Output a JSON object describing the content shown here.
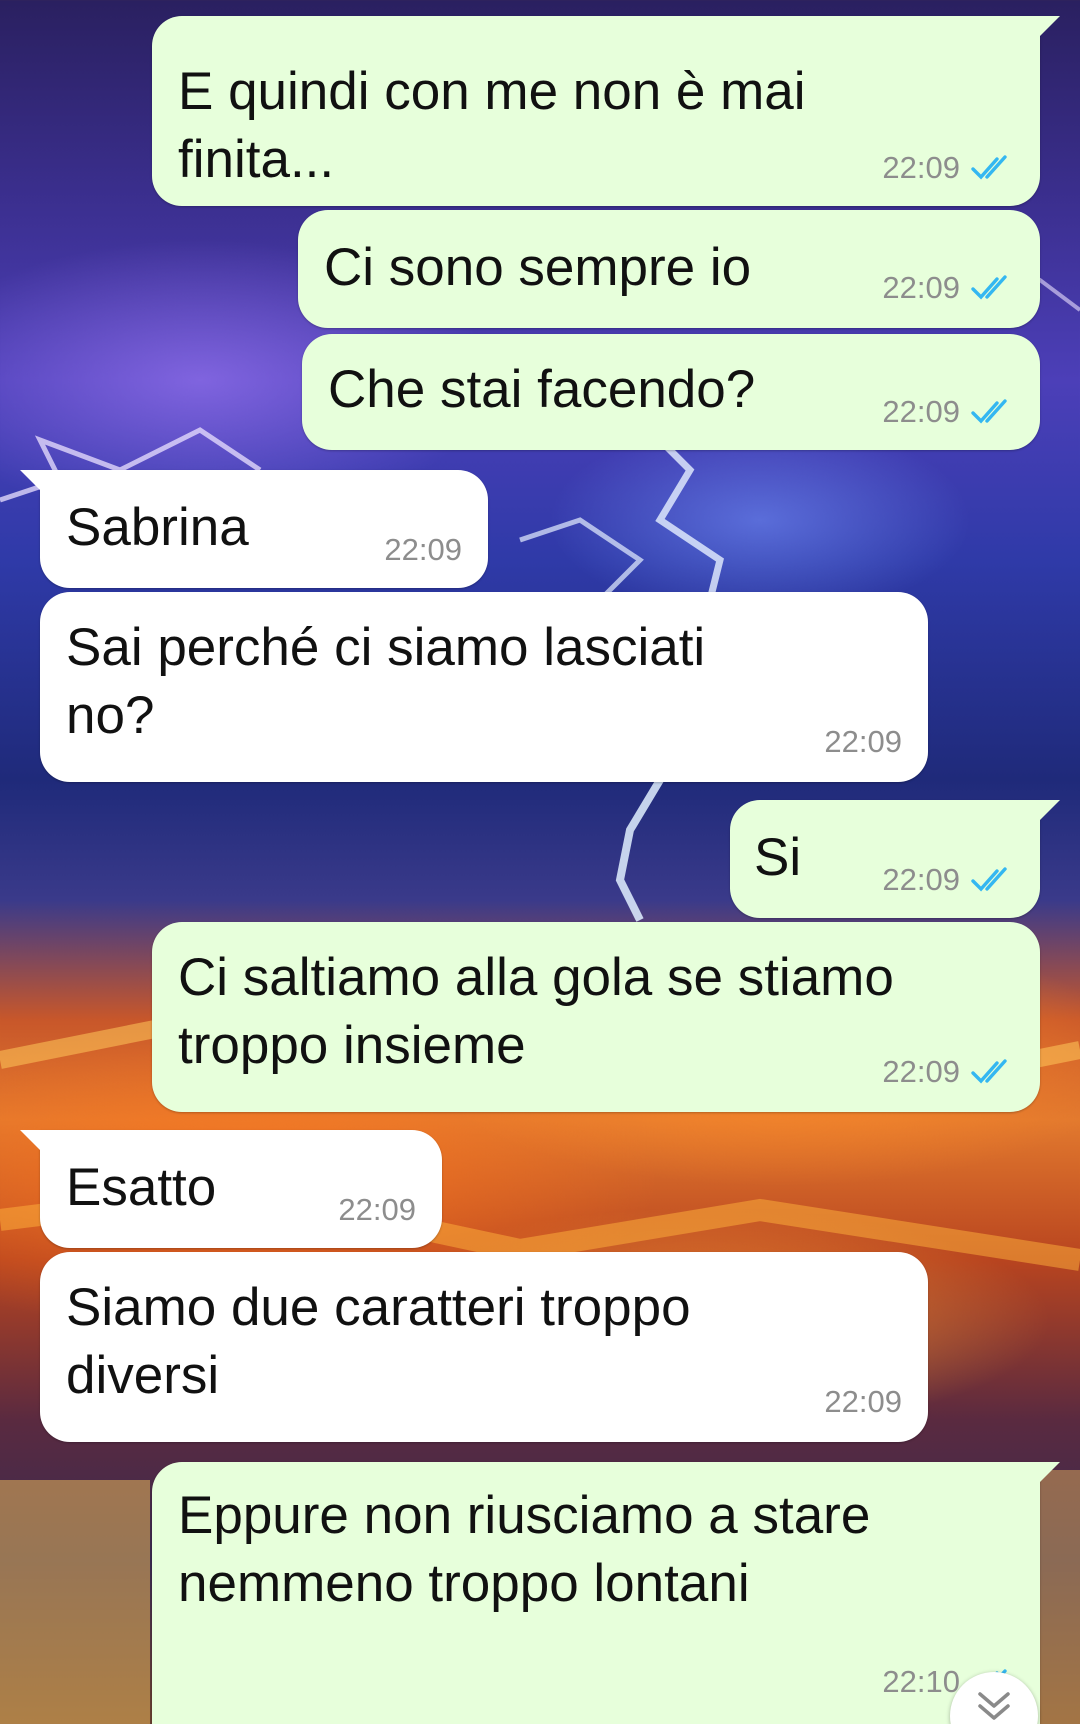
{
  "messages": [
    {
      "direction": "out",
      "lines": [
        "E quindi con me non è mai",
        "finita..."
      ],
      "time": "22:09",
      "status": "read"
    },
    {
      "direction": "out",
      "lines": [
        "Ci sono sempre io"
      ],
      "time": "22:09",
      "status": "read"
    },
    {
      "direction": "out",
      "lines": [
        "Che stai facendo?"
      ],
      "time": "22:09",
      "status": "read"
    },
    {
      "direction": "in",
      "lines": [
        "Sabrina"
      ],
      "time": "22:09"
    },
    {
      "direction": "in",
      "lines": [
        "Sai perché ci siamo lasciati",
        "no?"
      ],
      "time": "22:09"
    },
    {
      "direction": "out",
      "lines": [
        "Si"
      ],
      "time": "22:09",
      "status": "read"
    },
    {
      "direction": "out",
      "lines": [
        "Ci saltiamo alla gola se stiamo",
        "troppo insieme"
      ],
      "time": "22:09",
      "status": "read"
    },
    {
      "direction": "in",
      "lines": [
        "Esatto"
      ],
      "time": "22:09"
    },
    {
      "direction": "in",
      "lines": [
        "Siamo due caratteri troppo",
        "diversi"
      ],
      "time": "22:09"
    },
    {
      "direction": "out",
      "lines": [
        "Eppure non riusciamo a stare",
        "nemmeno troppo lontani"
      ],
      "time": "22:10",
      "status": "read"
    }
  ],
  "icons": {
    "read_receipt": "double-check-icon",
    "scroll_down": "chevron-double-down-icon"
  },
  "colors": {
    "outgoing_bubble": "#e7ffdb",
    "incoming_bubble": "#ffffff",
    "read_tick": "#34b7f1",
    "timestamp": "#8d8d8d"
  }
}
